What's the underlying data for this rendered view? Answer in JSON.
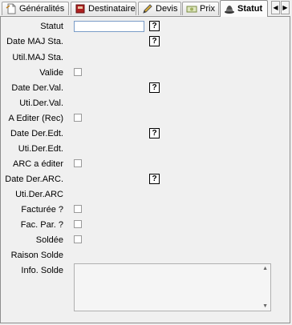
{
  "tabs": [
    {
      "label": "Généralités",
      "icon": "document-icon"
    },
    {
      "label": "Destinataire",
      "icon": "book-icon"
    },
    {
      "label": "Devis",
      "icon": "pencil-icon"
    },
    {
      "label": "Prix",
      "icon": "price-icon"
    },
    {
      "label": "Statut",
      "icon": "hat-icon",
      "active": true
    }
  ],
  "tab_scroll": {
    "left": "◀",
    "right": "▶"
  },
  "help_label": "?",
  "form": {
    "statut": "Statut",
    "date_maj_sta": "Date MAJ Sta.",
    "util_maj_sta": "Util.MAJ Sta.",
    "valide": "Valide",
    "date_der_val": "Date Der.Val.",
    "uti_der_val": "Uti.Der.Val.",
    "a_editer_rec": "A Editer (Rec)",
    "date_der_edt": "Date Der.Edt.",
    "uti_der_edt": "Uti.Der.Edt.",
    "arc_a_editer": "ARC a éditer",
    "date_der_arc": "Date Der.ARC.",
    "uti_der_arc": "Uti.Der.ARC",
    "facturee": "Facturée ?",
    "fac_par": "Fac. Par. ?",
    "soldee": "Soldée",
    "raison_solde": "Raison Solde",
    "info_solde": "Info. Solde"
  },
  "values": {
    "statut": "",
    "valide": false,
    "a_editer_rec": false,
    "arc_a_editer": false,
    "facturee": false,
    "fac_par": false,
    "soldee": false,
    "info_solde": ""
  }
}
